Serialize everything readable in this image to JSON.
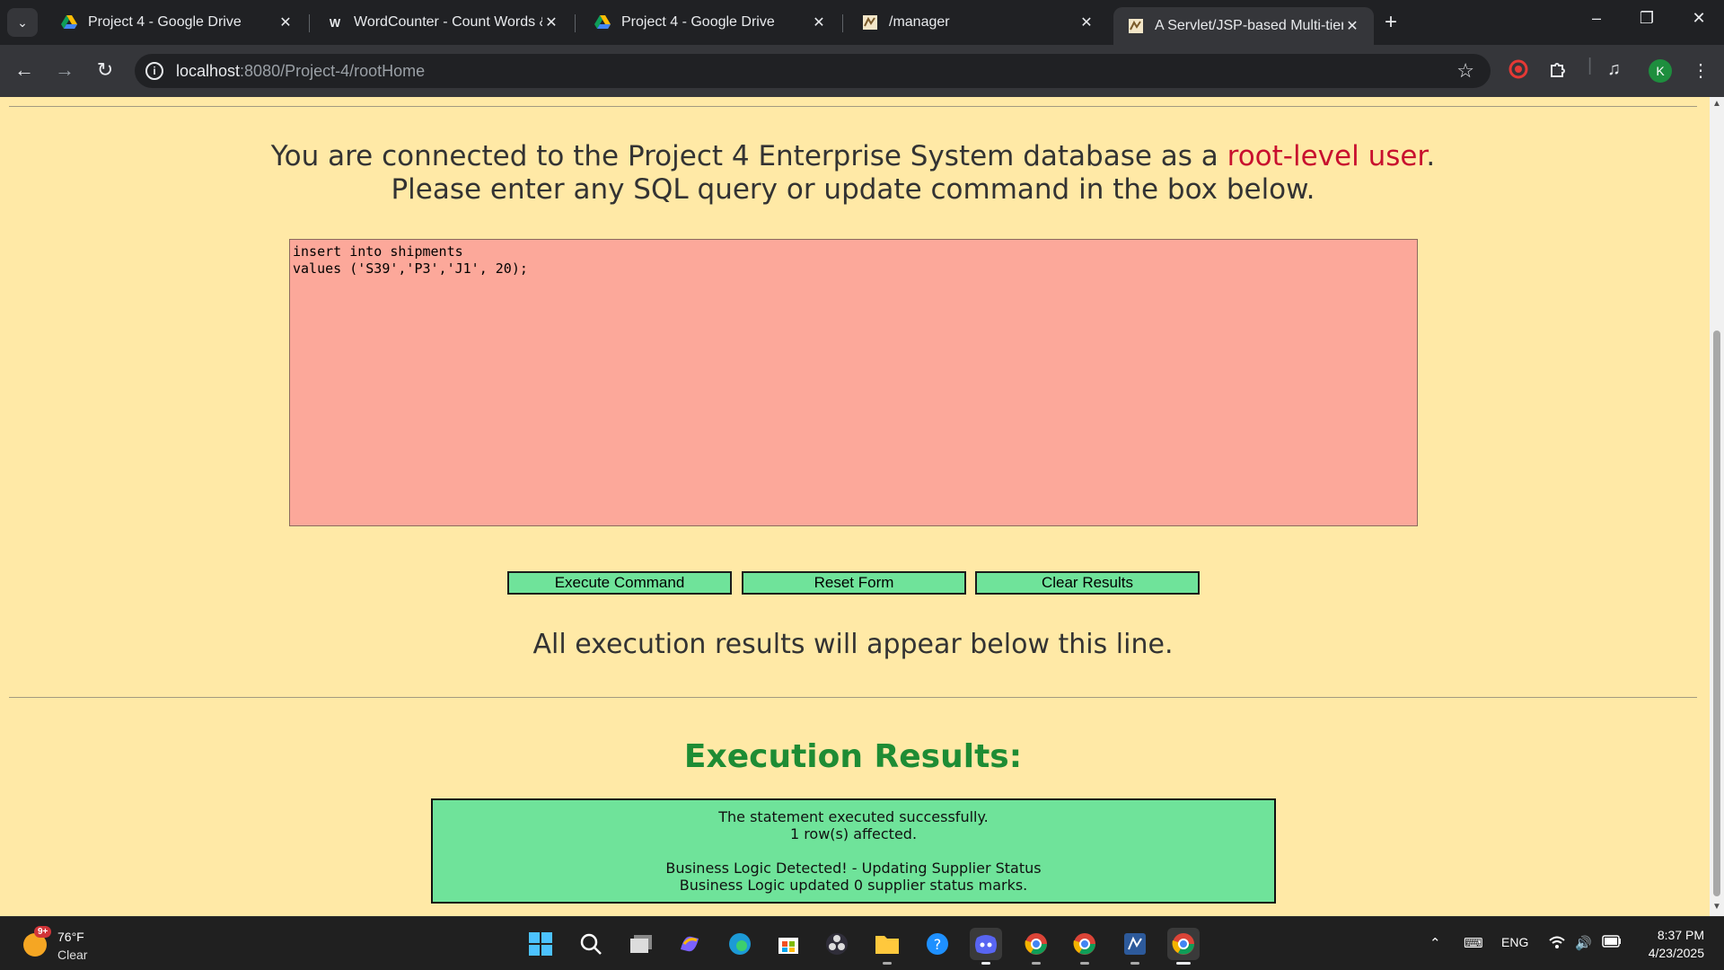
{
  "browser": {
    "tabs": [
      {
        "title": "Project 4 - Google Drive",
        "icon": "google-drive-icon"
      },
      {
        "title": "WordCounter - Count Words &",
        "icon": "wordcounter-icon"
      },
      {
        "title": "Project 4 - Google Drive",
        "icon": "google-drive-icon"
      },
      {
        "title": "/manager",
        "icon": "tomcat-icon"
      },
      {
        "title": "A Servlet/JSP-based Multi-tiere",
        "icon": "tomcat-icon",
        "active": true
      }
    ],
    "url_host": "localhost",
    "url_rest": ":8080/Project-4/rootHome",
    "profile_initial": "K"
  },
  "page": {
    "intro_before": "You are connected to the Project 4 Enterprise System database as a ",
    "intro_highlight": "root-level user",
    "intro_after": ".",
    "intro_line2": "Please enter any SQL query or update command in the box below.",
    "sql_text": "insert into shipments\nvalues ('S39','P3','J1', 20);",
    "buttons": {
      "execute": "Execute Command",
      "reset": "Reset Form",
      "clear": "Clear Results"
    },
    "results_note": "All execution results will appear below this line.",
    "results_title": "Execution Results:",
    "result_lines": {
      "line1": "The statement executed successfully.",
      "line2": "1 row(s) affected.",
      "line3": "Business Logic Detected! - Updating Supplier Status",
      "line4": "Business Logic updated 0 supplier status marks."
    },
    "colors": {
      "background": "#ffe9a6",
      "sql_box": "#fca89a",
      "button": "#6fe39a",
      "highlight": "#c8102e",
      "results_title": "#1e8c34"
    }
  },
  "taskbar": {
    "weather_badge": "9+",
    "temperature": "76°F",
    "condition": "Clear",
    "language": "ENG",
    "time": "8:37 PM",
    "date": "4/23/2025"
  }
}
